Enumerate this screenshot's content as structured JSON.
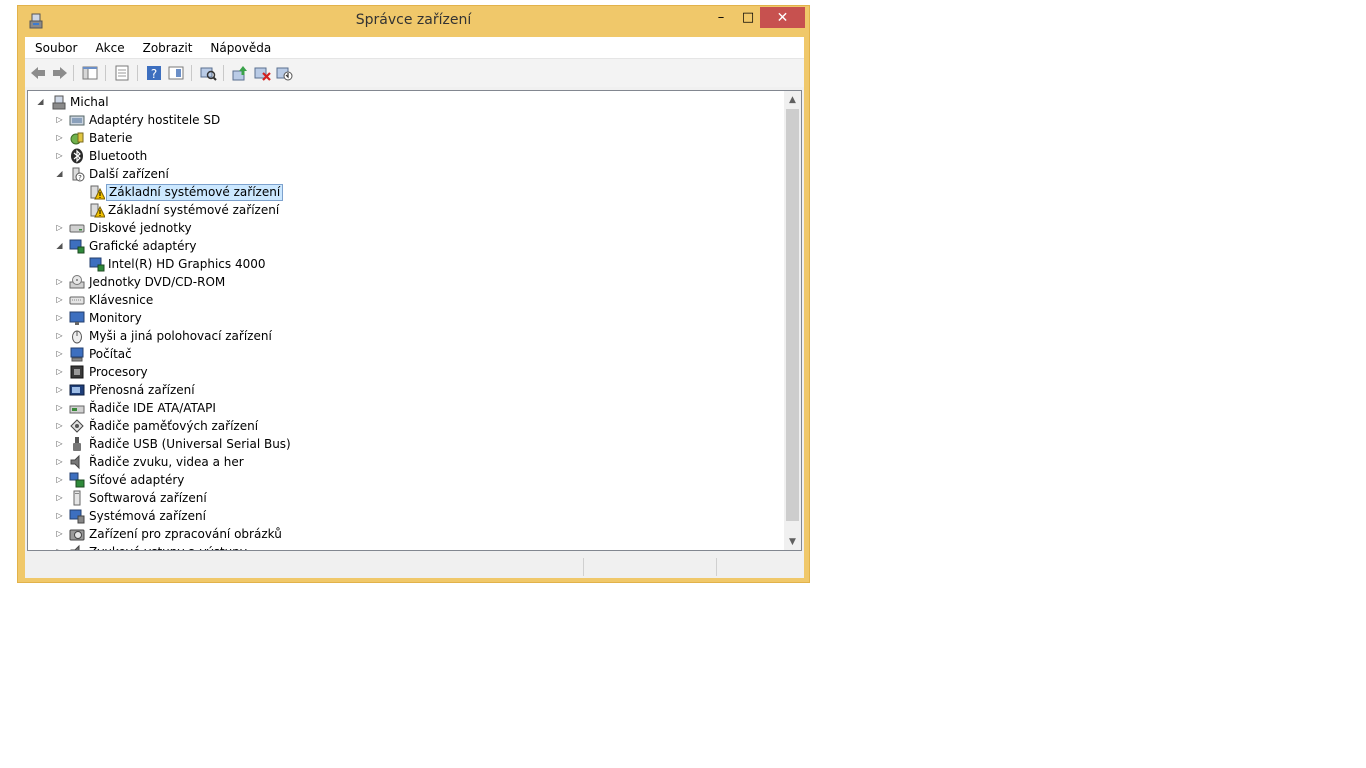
{
  "window": {
    "title": "Správce zařízení",
    "controls": {
      "minimize": "–",
      "maximize": "□",
      "close": "✕"
    },
    "accent_color": "#f0c86a",
    "close_color": "#c7514f"
  },
  "menu": [
    "Soubor",
    "Akce",
    "Zobrazit",
    "Nápověda"
  ],
  "toolbar": [
    "back-icon",
    "forward-icon",
    "console-tree-icon",
    "properties-icon",
    "help-icon",
    "view-icon",
    "scan-hardware-icon",
    "update-driver-icon",
    "uninstall-icon",
    "disable-icon"
  ],
  "tree": {
    "root": "Michal",
    "items": [
      {
        "label": "Adaptéry hostitele SD",
        "icon": "sd-host-icon",
        "expanded": false
      },
      {
        "label": "Baterie",
        "icon": "battery-icon",
        "expanded": false
      },
      {
        "label": "Bluetooth",
        "icon": "bluetooth-icon",
        "expanded": false
      },
      {
        "label": "Další zařízení",
        "icon": "other-devices-icon",
        "expanded": true
      },
      {
        "label": "Základní systémové zařízení",
        "icon": "warning-device-icon",
        "child": true,
        "selected": true
      },
      {
        "label": "Základní systémové zařízení",
        "icon": "warning-device-icon",
        "child": true
      },
      {
        "label": "Diskové jednotky",
        "icon": "disk-drive-icon",
        "expanded": false
      },
      {
        "label": "Grafické adaptéry",
        "icon": "display-adapter-icon",
        "expanded": true
      },
      {
        "label": "Intel(R) HD Graphics 4000",
        "icon": "display-adapter-icon",
        "child": true
      },
      {
        "label": "Jednotky DVD/CD-ROM",
        "icon": "dvd-drive-icon",
        "expanded": false
      },
      {
        "label": "Klávesnice",
        "icon": "keyboard-icon",
        "expanded": false
      },
      {
        "label": "Monitory",
        "icon": "monitor-icon",
        "expanded": false
      },
      {
        "label": "Myši a jiná polohovací zařízení",
        "icon": "mouse-icon",
        "expanded": false
      },
      {
        "label": "Počítač",
        "icon": "computer-icon",
        "expanded": false
      },
      {
        "label": "Procesory",
        "icon": "processor-icon",
        "expanded": false
      },
      {
        "label": "Přenosná zařízení",
        "icon": "portable-device-icon",
        "expanded": false
      },
      {
        "label": "Řadiče IDE ATA/ATAPI",
        "icon": "ide-controller-icon",
        "expanded": false
      },
      {
        "label": "Řadiče paměťových zařízení",
        "icon": "storage-controller-icon",
        "expanded": false
      },
      {
        "label": "Řadiče USB (Universal Serial Bus)",
        "icon": "usb-icon",
        "expanded": false
      },
      {
        "label": "Řadiče zvuku, videa a her",
        "icon": "sound-icon",
        "expanded": false
      },
      {
        "label": "Síťové adaptéry",
        "icon": "network-adapter-icon",
        "expanded": false
      },
      {
        "label": "Softwarová zařízení",
        "icon": "software-device-icon",
        "expanded": false
      },
      {
        "label": "Systémová zařízení",
        "icon": "system-device-icon",
        "expanded": false
      },
      {
        "label": "Zařízení pro zpracování obrázků",
        "icon": "imaging-device-icon",
        "expanded": false
      },
      {
        "label": "Zvukové vstupy a výstupy",
        "icon": "audio-io-icon",
        "expanded": false
      }
    ]
  }
}
